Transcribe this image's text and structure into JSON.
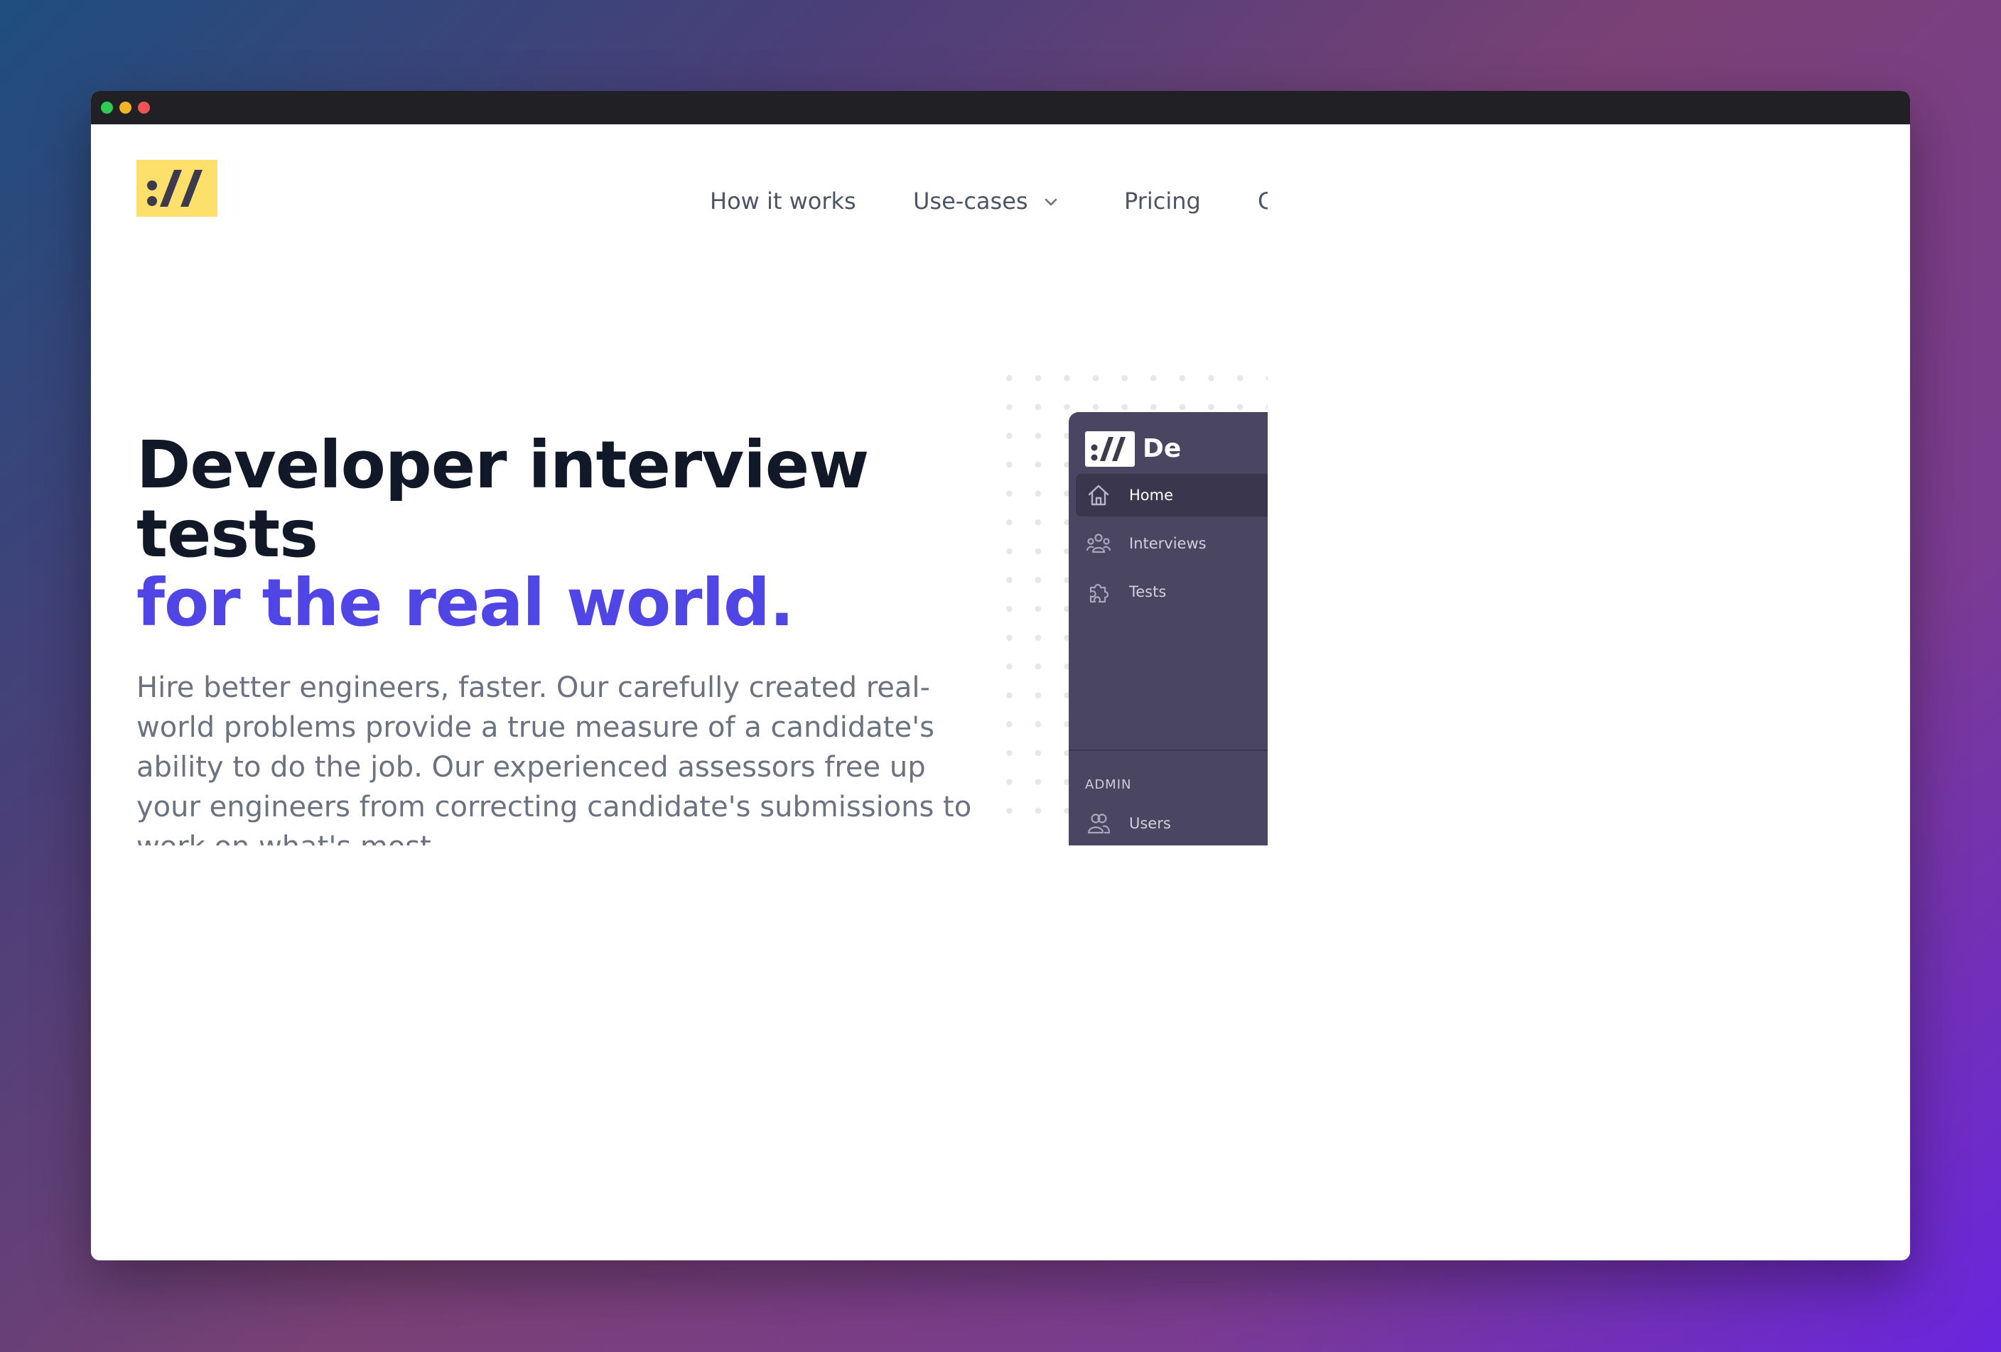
{
  "nav": {
    "items": [
      {
        "label": "How it works"
      },
      {
        "label": "Use-cases",
        "icon": "chevron-down-icon"
      },
      {
        "label": "Pricing"
      },
      {
        "label": "C"
      }
    ]
  },
  "hero": {
    "title_line1": "Developer interview tests",
    "title_line2": "for the real world.",
    "description": "Hire better engineers, faster. Our carefully created real-world problems provide a true measure of a candidate's ability to do the job. Our experienced assessors free up your engineers from correcting candidate's submissions to work on what's most"
  },
  "app_preview": {
    "title": "De",
    "items": [
      {
        "label": "Home",
        "icon": "home-icon"
      },
      {
        "label": "Interviews",
        "icon": "people-icon"
      },
      {
        "label": "Tests",
        "icon": "puzzle-icon"
      }
    ],
    "section_label": "ADMIN",
    "admin_items": [
      {
        "label": "Users",
        "icon": "users-icon"
      }
    ]
  },
  "colors": {
    "accent": "#4f46e5",
    "heading": "#111827",
    "logo_bg": "#fde06b",
    "panel": "#4a4560"
  }
}
